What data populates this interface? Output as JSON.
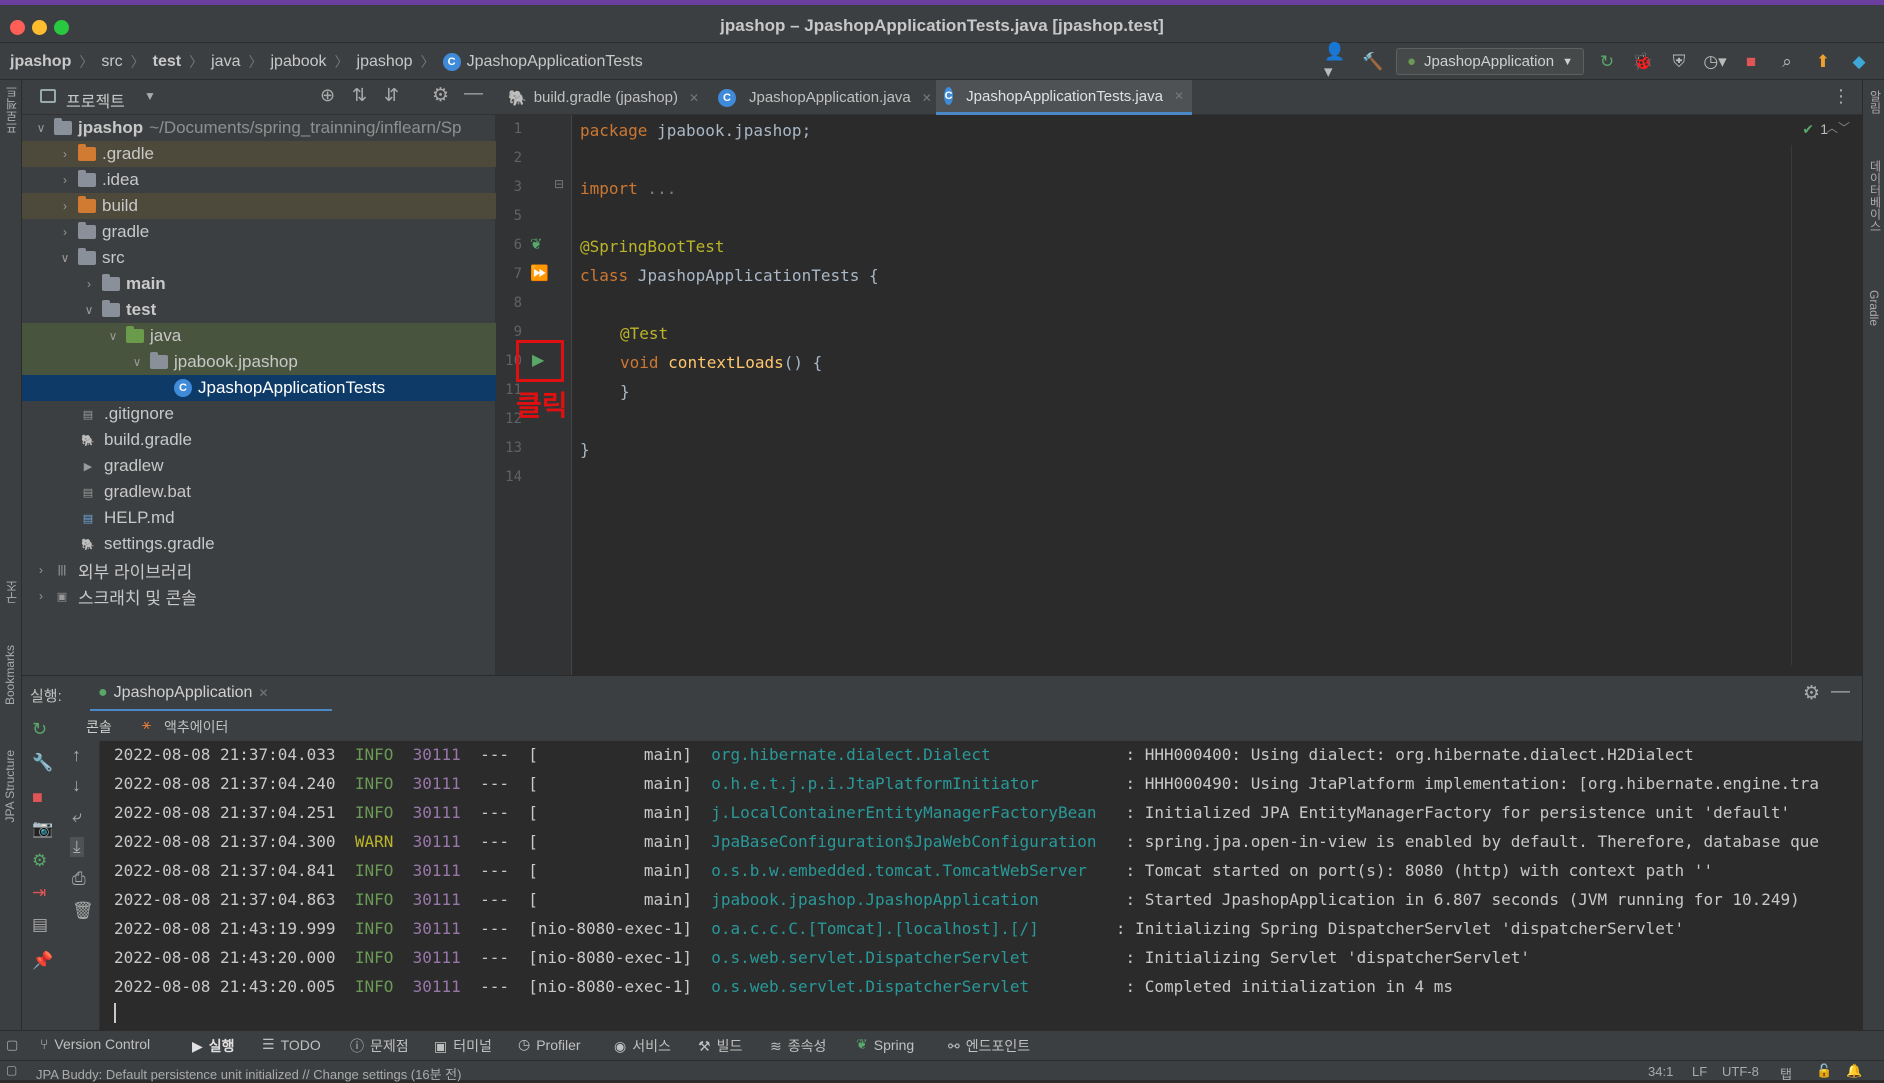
{
  "window": {
    "title": "jpashop – JpashopApplicationTests.java [jpashop.test]"
  },
  "breadcrumbs": [
    "jpashop",
    "src",
    "test",
    "java",
    "jpabook",
    "jpashop",
    "JpashopApplicationTests"
  ],
  "toolbar": {
    "run_config": "JpashopApplication"
  },
  "project_panel": {
    "title": "프로젝트",
    "root_name": "jpashop",
    "root_path": "~/Documents/spring_trainning/inflearn/Sp",
    "items": [
      {
        "label": ".gradle"
      },
      {
        "label": ".idea"
      },
      {
        "label": "build"
      },
      {
        "label": "gradle"
      },
      {
        "label": "src"
      },
      {
        "label": "main"
      },
      {
        "label": "test"
      },
      {
        "label": "java"
      },
      {
        "label": "jpabook.jpashop"
      },
      {
        "label": "JpashopApplicationTests"
      },
      {
        "label": ".gitignore"
      },
      {
        "label": "build.gradle"
      },
      {
        "label": "gradlew"
      },
      {
        "label": "gradlew.bat"
      },
      {
        "label": "HELP.md"
      },
      {
        "label": "settings.gradle"
      },
      {
        "label": "외부 라이브러리"
      },
      {
        "label": "스크래치 및 콘솔"
      }
    ]
  },
  "editor_tabs": [
    {
      "label": "build.gradle (jpashop)"
    },
    {
      "label": "JpashopApplication.java"
    },
    {
      "label": "JpashopApplicationTests.java"
    }
  ],
  "editor": {
    "line_numbers": [
      "1",
      "2",
      "3",
      "5",
      "6",
      "7",
      "8",
      "9",
      "10",
      "11",
      "12",
      "13",
      "14"
    ],
    "code": {
      "l1_kw": "package",
      "l1_rest": " jpabook.jpashop;",
      "l3_kw": "import",
      "l3_rest": " ...",
      "l6": "@SpringBootTest",
      "l7_kw": "class",
      "l7_rest": " JpashopApplicationTests {",
      "l9": "@Test",
      "l10_kw": "void",
      "l10_fn": "contextLoads",
      "l10_rest": "() {",
      "l11": "}",
      "l13": "}"
    },
    "inspection_count": "1",
    "annotation_label": "클릭"
  },
  "run_panel": {
    "label": "실행:",
    "config_tab": "JpashopApplication",
    "sub_tabs": [
      "콘솔",
      "액추에이터"
    ]
  },
  "console_lines": [
    {
      "ts": "2022-08-08 21:37:04.033",
      "level": "INFO",
      "pid": "30111",
      "thread": "---  [           main]",
      "logger": "org.hibernate.dialect.Dialect            ",
      "msg": ": HHH000400: Using dialect: org.hibernate.dialect.H2Dialect"
    },
    {
      "ts": "2022-08-08 21:37:04.240",
      "level": "INFO",
      "pid": "30111",
      "thread": "---  [           main]",
      "logger": "o.h.e.t.j.p.i.JtaPlatformInitiator       ",
      "msg": ": HHH000490: Using JtaPlatform implementation: [org.hibernate.engine.tra"
    },
    {
      "ts": "2022-08-08 21:37:04.251",
      "level": "INFO",
      "pid": "30111",
      "thread": "---  [           main]",
      "logger": "j.LocalContainerEntityManagerFactoryBean ",
      "msg": ": Initialized JPA EntityManagerFactory for persistence unit 'default'"
    },
    {
      "ts": "2022-08-08 21:37:04.300",
      "level": "WARN",
      "pid": "30111",
      "thread": "---  [           main]",
      "logger": "JpaBaseConfiguration$JpaWebConfiguration ",
      "msg": ": spring.jpa.open-in-view is enabled by default. Therefore, database que"
    },
    {
      "ts": "2022-08-08 21:37:04.841",
      "level": "INFO",
      "pid": "30111",
      "thread": "---  [           main]",
      "logger": "o.s.b.w.embedded.tomcat.TomcatWebServer  ",
      "msg": ": Tomcat started on port(s): 8080 (http) with context path ''"
    },
    {
      "ts": "2022-08-08 21:37:04.863",
      "level": "INFO",
      "pid": "30111",
      "thread": "---  [           main]",
      "logger": "jpabook.jpashop.JpashopApplication       ",
      "msg": ": Started JpashopApplication in 6.807 seconds (JVM running for 10.249)"
    },
    {
      "ts": "2022-08-08 21:43:19.999",
      "level": "INFO",
      "pid": "30111",
      "thread": "---  [nio-8080-exec-1]",
      "logger": "o.a.c.c.C.[Tomcat].[localhost].[/]      ",
      "msg": ": Initializing Spring DispatcherServlet 'dispatcherServlet'"
    },
    {
      "ts": "2022-08-08 21:43:20.000",
      "level": "INFO",
      "pid": "30111",
      "thread": "---  [nio-8080-exec-1]",
      "logger": "o.s.web.servlet.DispatcherServlet        ",
      "msg": ": Initializing Servlet 'dispatcherServlet'"
    },
    {
      "ts": "2022-08-08 21:43:20.005",
      "level": "INFO",
      "pid": "30111",
      "thread": "---  [nio-8080-exec-1]",
      "logger": "o.s.web.servlet.DispatcherServlet        ",
      "msg": ": Completed initialization in 4 ms"
    }
  ],
  "tool_windows": [
    "Version Control",
    "실행",
    "TODO",
    "문제점",
    "터미널",
    "Profiler",
    "서비스",
    "빌드",
    "종속성",
    "Spring",
    "엔드포인트"
  ],
  "left_strip": {
    "project": "프로젝트",
    "structure": "구조",
    "bookmarks": "Bookmarks",
    "jpa": "JPA Structure"
  },
  "right_strip": {
    "notify": "알림",
    "database": "데이터베이스",
    "gradle": "Gradle"
  },
  "status": {
    "message": "JPA Buddy: Default persistence unit initialized // Change settings (16분 전)",
    "position": "34:1",
    "line_sep": "LF",
    "encoding": "UTF-8",
    "indent": "탭"
  }
}
